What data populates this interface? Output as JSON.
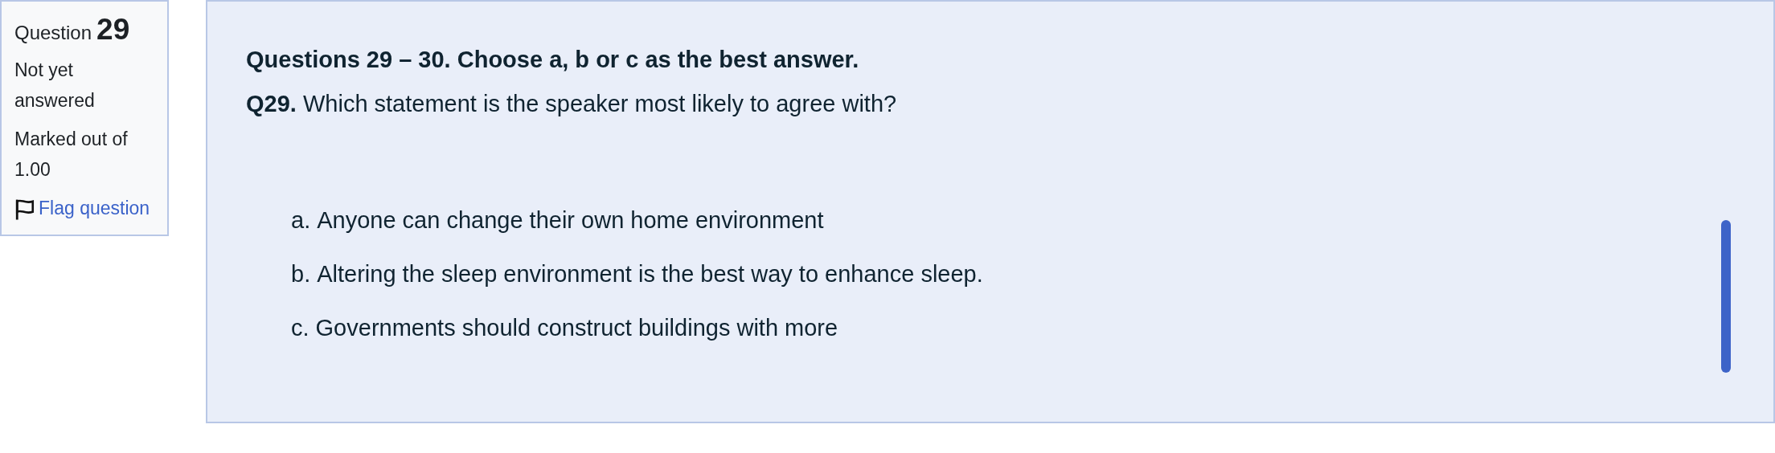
{
  "question_info": {
    "label": "Question",
    "number": "29",
    "status": "Not yet answered",
    "marks": "Marked out of 1.00",
    "flag": {
      "label": "Flag question",
      "flagged": false
    }
  },
  "question": {
    "instruction": "Questions 29 – 30. Choose a, b or c as the best answer.",
    "prompt": "**Q29.** Which statement is the speaker most likely to agree with?"
  },
  "options": [
    {
      "letter": "a.",
      "text": "Anyone can change their own home environment"
    },
    {
      "letter": "b.",
      "text": "Altering the sleep environment is the best way to enhance sleep."
    },
    {
      "letter": "c.",
      "text": "Governments should construct buildings with more"
    }
  ]
}
